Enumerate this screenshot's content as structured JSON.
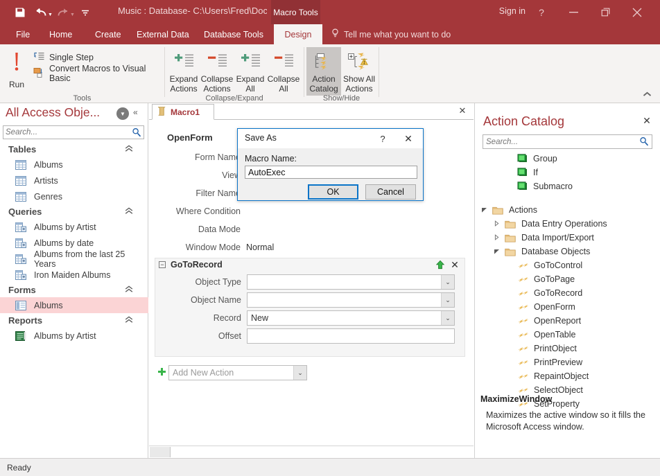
{
  "titlebar": {
    "window_title": "Music : Database- C:\\Users\\Fred\\Docume...",
    "context_tab": "Macro Tools",
    "signin": "Sign in",
    "save_icon": "save-icon",
    "undo_icon": "undo-icon",
    "redo_icon": "redo-icon",
    "customize_icon": "customize-quick-access-icon",
    "help_icon": "?",
    "minimize_icon": "minimize-icon",
    "restore_icon": "restore-icon",
    "close_icon": "close-icon",
    "accent": "#a4373a"
  },
  "ribbon": {
    "tabs": [
      {
        "label": "File",
        "active": false
      },
      {
        "label": "Home",
        "active": false
      },
      {
        "label": "Create",
        "active": false
      },
      {
        "label": "External Data",
        "active": false
      },
      {
        "label": "Database Tools",
        "active": false
      },
      {
        "label": "Design",
        "active": true
      }
    ],
    "tellme": "Tell me what you want to do",
    "tellme_icon": "lightbulb-icon",
    "collapse_icon": "chevron-up-icon",
    "groups": [
      {
        "name": "Tools"
      },
      {
        "name": "Collapse/Expand"
      },
      {
        "name": "Show/Hide"
      }
    ],
    "run": {
      "label": "Run",
      "icon": "exclamation-run-icon"
    },
    "tools": [
      {
        "label": "Single Step",
        "icon": "single-step-icon"
      },
      {
        "label": "Convert Macros to Visual Basic",
        "icon": "convert-macros-icon"
      }
    ],
    "collapse_expand": [
      {
        "line1": "Expand",
        "line2": "Actions",
        "icon": "expand-actions-icon",
        "active": false
      },
      {
        "line1": "Collapse",
        "line2": "Actions",
        "icon": "collapse-actions-icon",
        "active": false
      },
      {
        "line1": "Expand",
        "line2": "All",
        "icon": "expand-all-icon",
        "active": false
      },
      {
        "line1": "Collapse",
        "line2": "All",
        "icon": "collapse-all-icon",
        "active": false
      }
    ],
    "show_hide": [
      {
        "line1": "Action",
        "line2": "Catalog",
        "icon": "action-catalog-icon",
        "active": true
      },
      {
        "line1": "Show All",
        "line2": "Actions",
        "icon": "show-all-actions-icon",
        "active": false
      }
    ]
  },
  "navpane": {
    "title": "All Access Obje...",
    "dropdown_icon": "chevron-down-icon",
    "collapse_icon": "double-chevron-left-icon",
    "search_placeholder": "Search...",
    "search_value": "",
    "search_icon": "search-icon",
    "groups": [
      {
        "label": "Tables",
        "collapse_icon": "double-chevron-up-icon",
        "items": [
          {
            "label": "Albums",
            "icon": "table-icon",
            "selected": false
          },
          {
            "label": "Artists",
            "icon": "table-icon",
            "selected": false
          },
          {
            "label": "Genres",
            "icon": "table-icon",
            "selected": false
          }
        ]
      },
      {
        "label": "Queries",
        "collapse_icon": "double-chevron-up-icon",
        "items": [
          {
            "label": "Albums by Artist",
            "icon": "query-icon",
            "selected": false
          },
          {
            "label": "Albums by date",
            "icon": "query-icon",
            "selected": false
          },
          {
            "label": "Albums from the last 25 Years",
            "icon": "query-icon",
            "selected": false
          },
          {
            "label": "Iron Maiden Albums",
            "icon": "query-icon",
            "selected": false
          }
        ]
      },
      {
        "label": "Forms",
        "collapse_icon": "double-chevron-up-icon",
        "items": [
          {
            "label": "Albums",
            "icon": "form-icon",
            "selected": true
          }
        ]
      },
      {
        "label": "Reports",
        "collapse_icon": "double-chevron-up-icon",
        "items": [
          {
            "label": "Albums by Artist",
            "icon": "report-icon",
            "selected": false
          }
        ]
      }
    ]
  },
  "document": {
    "tab_label": "Macro1",
    "tab_icon": "macro-icon",
    "close_icon": "close-icon",
    "blocks": [
      {
        "name": "OpenForm",
        "style": "plain",
        "args": [
          {
            "label": "Form Name",
            "value": "",
            "control": "text"
          },
          {
            "label": "View",
            "value": "",
            "control": "text"
          },
          {
            "label": "Filter Name",
            "value": "",
            "control": "text"
          },
          {
            "label": "Where Condition",
            "value": "",
            "control": "text"
          },
          {
            "label": "Data Mode",
            "value": "",
            "control": "text"
          },
          {
            "label": "Window Mode",
            "value": "Normal",
            "control": "text"
          }
        ]
      },
      {
        "name": "GoToRecord",
        "style": "panel",
        "expander": "−",
        "move_up_icon": "green-up-arrow-icon",
        "delete_icon": "close-icon",
        "args": [
          {
            "label": "Object Type",
            "value": "",
            "control": "combo"
          },
          {
            "label": "Object Name",
            "value": "",
            "control": "combo"
          },
          {
            "label": "Record",
            "value": "New",
            "control": "combo"
          },
          {
            "label": "Offset",
            "value": "",
            "control": "textbox"
          }
        ]
      }
    ],
    "add_new_action": {
      "placeholder": "Add New Action",
      "plus_icon": "green-plus-icon",
      "arrow_icon": "chevron-down-icon"
    }
  },
  "catalog": {
    "title": "Action Catalog",
    "close_icon": "close-icon",
    "search_placeholder": "Search...",
    "search_value": "",
    "search_icon": "search-icon",
    "program_flow": [
      {
        "label": "Group",
        "icon": "program-flow-icon",
        "indent": 2
      },
      {
        "label": "If",
        "icon": "program-flow-icon",
        "indent": 2
      },
      {
        "label": "Submacro",
        "icon": "program-flow-icon",
        "indent": 2
      }
    ],
    "tree": [
      {
        "label": "Actions",
        "icon": "folder-icon",
        "indent": 0,
        "twist": "expanded"
      },
      {
        "label": "Data Entry Operations",
        "icon": "folder-icon",
        "indent": 1,
        "twist": "collapsed"
      },
      {
        "label": "Data Import/Export",
        "icon": "folder-icon",
        "indent": 1,
        "twist": "collapsed"
      },
      {
        "label": "Database Objects",
        "icon": "folder-icon",
        "indent": 1,
        "twist": "expanded"
      },
      {
        "label": "GoToControl",
        "icon": "action-icon",
        "indent": 2,
        "twist": "none"
      },
      {
        "label": "GoToPage",
        "icon": "action-icon",
        "indent": 2,
        "twist": "none"
      },
      {
        "label": "GoToRecord",
        "icon": "action-icon",
        "indent": 2,
        "twist": "none"
      },
      {
        "label": "OpenForm",
        "icon": "action-icon",
        "indent": 2,
        "twist": "none"
      },
      {
        "label": "OpenReport",
        "icon": "action-icon",
        "indent": 2,
        "twist": "none"
      },
      {
        "label": "OpenTable",
        "icon": "action-icon",
        "indent": 2,
        "twist": "none"
      },
      {
        "label": "PrintObject",
        "icon": "action-icon",
        "indent": 2,
        "twist": "none"
      },
      {
        "label": "PrintPreview",
        "icon": "action-icon",
        "indent": 2,
        "twist": "none"
      },
      {
        "label": "RepaintObject",
        "icon": "action-icon",
        "indent": 2,
        "twist": "none"
      },
      {
        "label": "SelectObject",
        "icon": "action-icon",
        "indent": 2,
        "twist": "none"
      },
      {
        "label": "SetProperty",
        "icon": "action-icon",
        "indent": 2,
        "twist": "none"
      }
    ],
    "description_title": "MaximizeWindow",
    "description_body": "Maximizes the active window so it fills the Microsoft Access window."
  },
  "dialog": {
    "title": "Save As",
    "help_label": "?",
    "close_icon": "close-icon",
    "field_label": "Macro Name:",
    "field_value": "AutoExec",
    "ok_label": "OK",
    "cancel_label": "Cancel"
  },
  "statusbar": {
    "text": "Ready"
  }
}
